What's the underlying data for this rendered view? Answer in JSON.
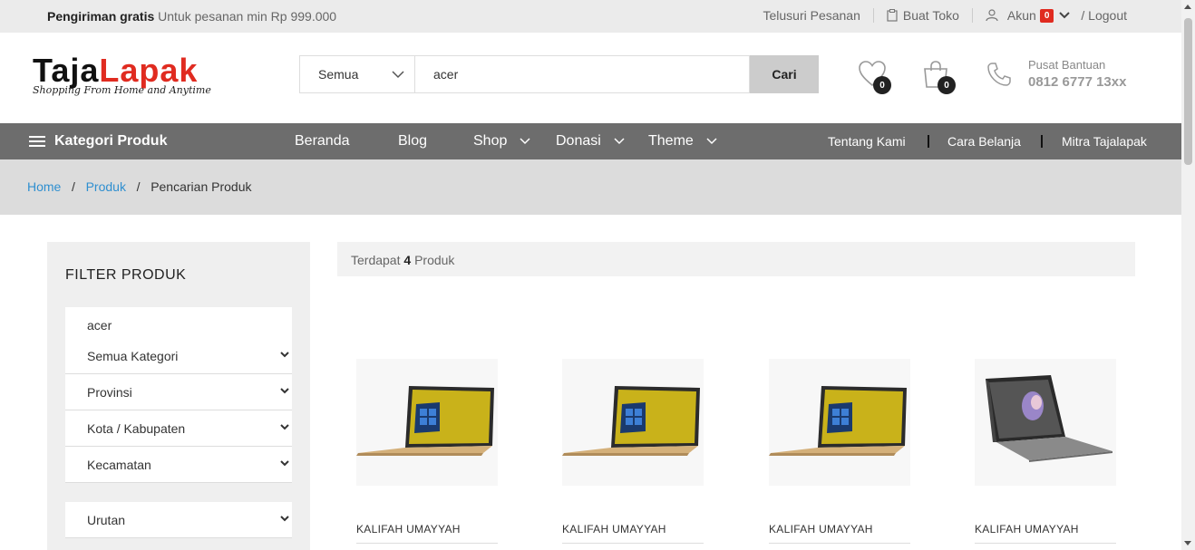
{
  "topbar": {
    "shipping_bold": "Pengiriman gratis",
    "shipping_text": "Untuk pesanan min Rp 999.000",
    "track_orders": "Telusuri Pesanan",
    "create_store": "Buat Toko",
    "account": "Akun",
    "account_badge": "0",
    "logout": "/ Logout"
  },
  "header": {
    "logo_part1": "Taja",
    "logo_part2": "Lapak",
    "logo_tagline": "Shopping From Home and Anytime",
    "search_category": "Semua",
    "search_value": "acer",
    "search_button": "Cari",
    "wishlist_count": "0",
    "cart_count": "0",
    "help_title": "Pusat Bantuan",
    "help_phone": "0812 6777 13xx"
  },
  "nav": {
    "categories": "Kategori Produk",
    "items": [
      "Beranda",
      "Blog",
      "Shop",
      "Donasi",
      "Theme"
    ],
    "right_items": [
      "Tentang Kami",
      "Cara Belanja",
      "Mitra Tajalapak"
    ]
  },
  "breadcrumb": {
    "home": "Home",
    "products": "Produk",
    "current": "Pencarian Produk"
  },
  "filter": {
    "title": "FILTER PRODUK",
    "keyword": "acer",
    "category": "Semua Kategori",
    "province": "Provinsi",
    "city": "Kota / Kabupaten",
    "district": "Kecamatan",
    "sort": "Urutan"
  },
  "results": {
    "prefix": "Terdapat",
    "count": "4",
    "suffix": "Produk"
  },
  "products": [
    {
      "store": "KALIFAH UMAYYAH",
      "image": "laptop-gold"
    },
    {
      "store": "KALIFAH UMAYYAH",
      "image": "laptop-gold"
    },
    {
      "store": "KALIFAH UMAYYAH",
      "image": "laptop-gold"
    },
    {
      "store": "KALIFAH UMAYYAH",
      "image": "tablet-surface"
    }
  ],
  "colors": {
    "accent_red": "#e02b20",
    "nav_bg": "#6d6d6d",
    "link_blue": "#2f8fd0"
  }
}
